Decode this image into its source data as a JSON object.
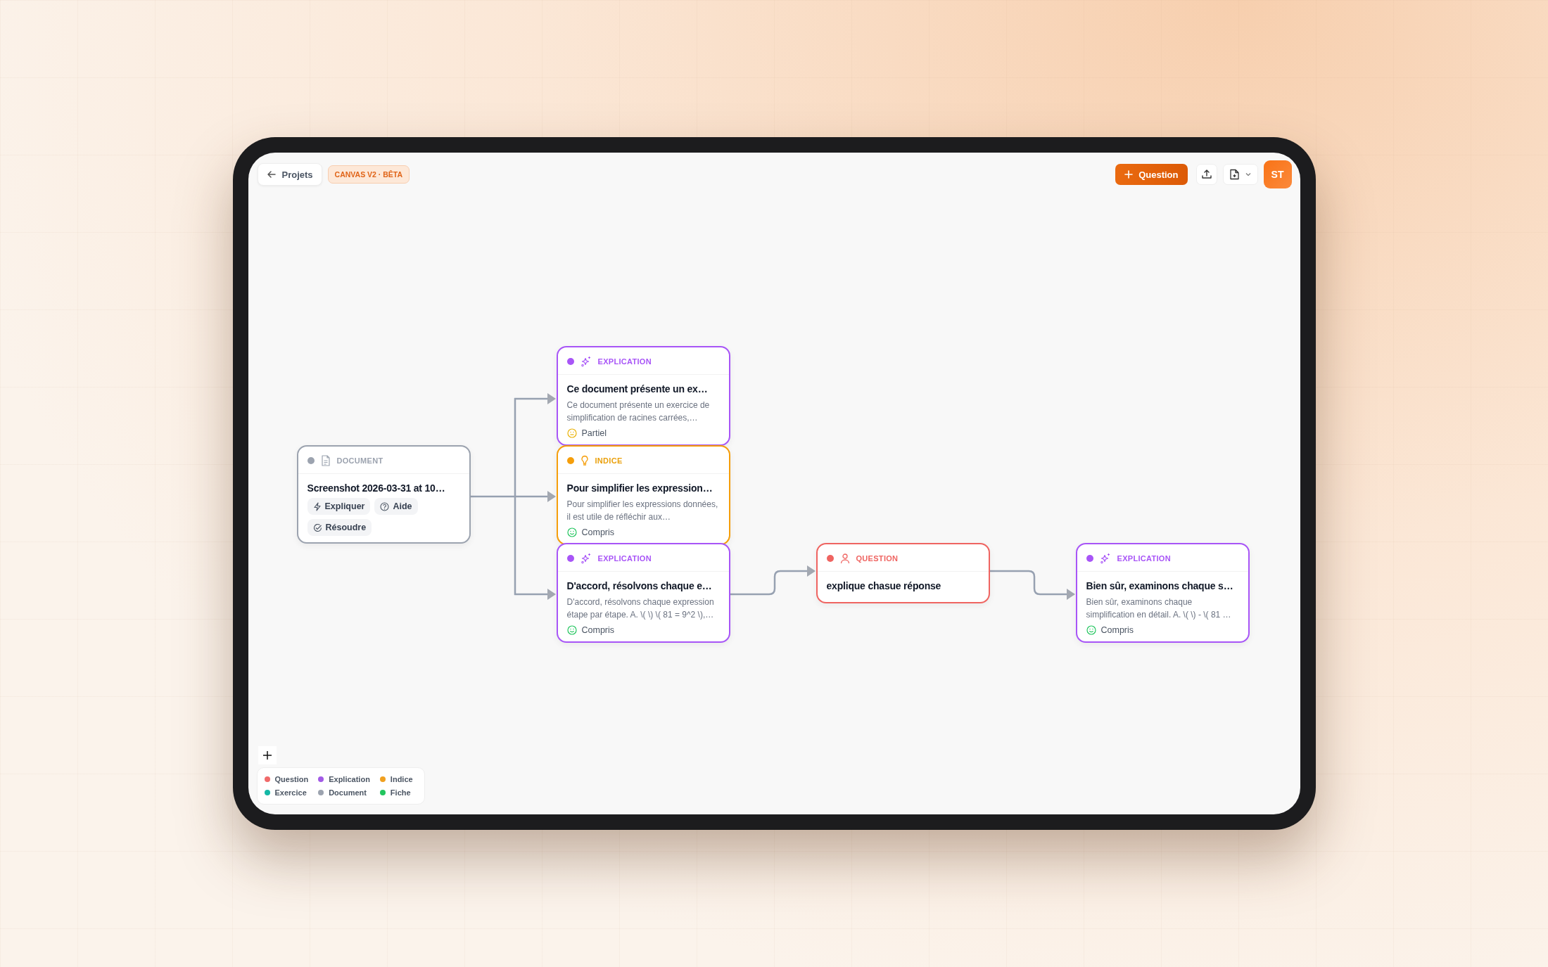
{
  "header": {
    "back_label": "Projets",
    "badge": "CANVAS V2 · BÊTA",
    "add_button": "Question",
    "avatar": "ST"
  },
  "nodes": [
    {
      "kind": "document",
      "type_label": "DOCUMENT",
      "title": "Screenshot 2026-03-31 at 10…",
      "actions": [
        {
          "kind": "explain",
          "label": "Expliquer"
        },
        {
          "kind": "help",
          "label": "Aide"
        },
        {
          "kind": "solve",
          "label": "Résoudre"
        }
      ]
    },
    {
      "kind": "explication",
      "type_label": "EXPLICATION",
      "title": "Ce document présente un ex…",
      "description": "Ce document présente un exercice de simplification de racines carrées,…",
      "status": {
        "kind": "partial",
        "label": "Partiel"
      }
    },
    {
      "kind": "indice",
      "type_label": "INDICE",
      "title": "Pour simplifier les expression…",
      "description": "Pour simplifier les expressions données, il est utile de réfléchir aux…",
      "status": {
        "kind": "understood",
        "label": "Compris"
      }
    },
    {
      "kind": "explication",
      "type_label": "EXPLICATION",
      "title": "D'accord, résolvons chaque e…",
      "description": "D'accord, résolvons chaque expression étape par étape. A. \\( \\) \\( 81 = 9^2 \\),…",
      "status": {
        "kind": "understood",
        "label": "Compris"
      }
    },
    {
      "kind": "question",
      "type_label": "QUESTION",
      "title": "explique chasue réponse"
    },
    {
      "kind": "explication",
      "type_label": "EXPLICATION",
      "title": "Bien sûr, examinons chaque s…",
      "description": "Bien sûr, examinons chaque simplification en détail. A. \\( \\) - \\( 81 …",
      "status": {
        "kind": "understood",
        "label": "Compris"
      }
    }
  ],
  "legend": [
    {
      "label": "Question",
      "color": "#f06a6a"
    },
    {
      "label": "Explication",
      "color": "#a25ae6"
    },
    {
      "label": "Indice",
      "color": "#f0a020"
    },
    {
      "label": "Exercice",
      "color": "#14b8a6"
    },
    {
      "label": "Document",
      "color": "#9ca3af"
    },
    {
      "label": "Fiche",
      "color": "#22c55e"
    }
  ]
}
